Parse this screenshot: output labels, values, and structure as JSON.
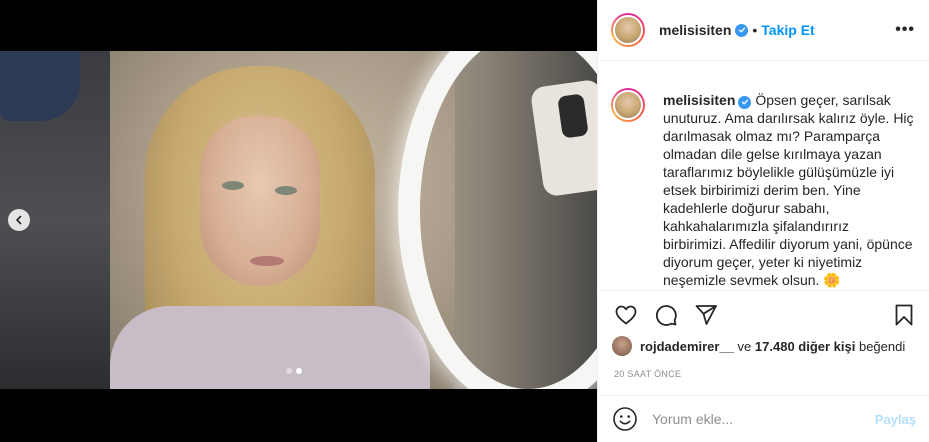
{
  "post": {
    "username": "melisisiten",
    "follow_label": "Takip Et",
    "separator": "•",
    "more_label": "•••",
    "caption_text": "Öpsen geçer, sarılsak unuturuz. Ama darılırsak kalırız öyle. Hiç darılmasak olmaz mı? Paramparça olmadan dile gelse kırılmaya yazan taraflarımız böylelikle gülüşümüzle iyi etsek birbirimizi derim ben. Yine kadehlerle doğurur sabahı, kahkahalarımızla şifalandırırız birbirimizi. Affedilir diyorum yani, öpünce diyorum geçer, yeter ki niyetimiz neşemizle sevmek olsun. 🌼",
    "carousel": {
      "total": 2,
      "active": 2
    }
  },
  "likes": {
    "liker": "rojdademirer__",
    "conjunction": " ve ",
    "others": "17.480 diğer kişi",
    "suffix": " beğendi"
  },
  "timestamp": "20 SAAT ÖNCE",
  "comment": {
    "placeholder": "Yorum ekle...",
    "post_label": "Paylaş"
  },
  "icons": {
    "verified": "verified-badge-icon",
    "like": "heart-icon",
    "comment": "comment-icon",
    "share": "send-icon",
    "save": "bookmark-icon",
    "emoji": "emoji-icon",
    "prev": "chevron-left-icon"
  },
  "colors": {
    "accent": "#0095f6",
    "verified": "#3897f0",
    "post_disabled": "#b2dffc",
    "muted": "#8e8e8e"
  }
}
